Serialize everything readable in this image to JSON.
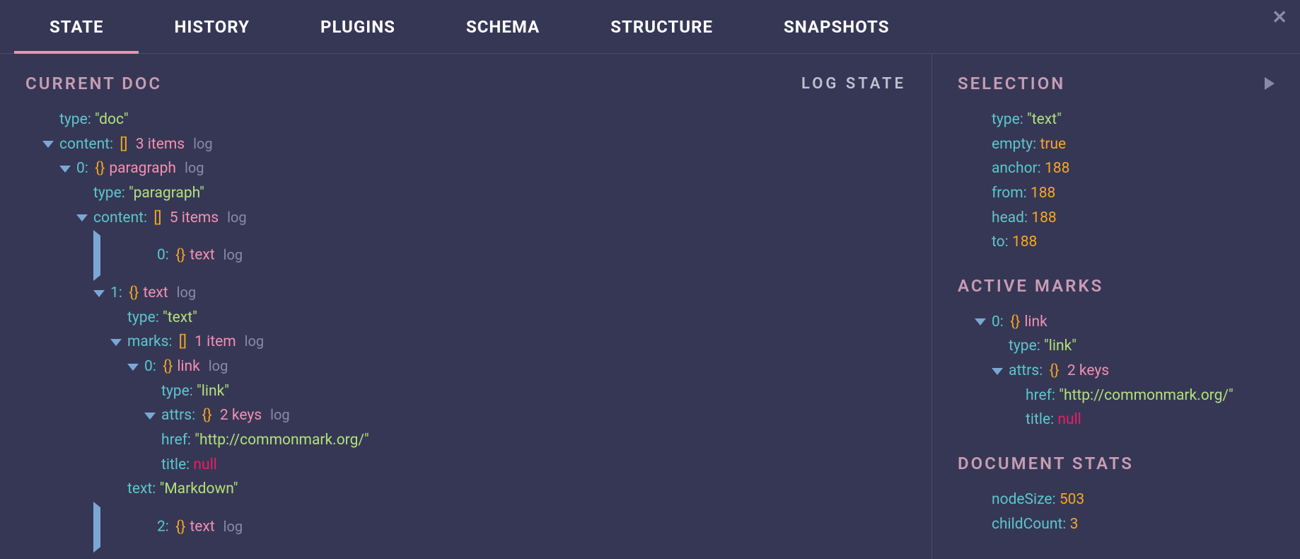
{
  "tabs": {
    "state": "STATE",
    "history": "HISTORY",
    "plugins": "PLUGINS",
    "schema": "SCHEMA",
    "structure": "STRUCTURE",
    "snapshots": "SNAPSHOTS"
  },
  "logState": "LOG STATE",
  "logLabel": "log",
  "headers": {
    "currentDoc": "CURRENT DOC",
    "selection": "SELECTION",
    "activeMarks": "ACTIVE MARKS",
    "documentStats": "DOCUMENT STATS"
  },
  "doc": {
    "typeKey": "type:",
    "typeVal": "\"doc\"",
    "contentKey": "content:",
    "contentBrace": "[]",
    "contentCount": "3 items",
    "item0": {
      "idx": "0:",
      "brace": "{}",
      "name": "paragraph",
      "typeKey": "type:",
      "typeVal": "\"paragraph\"",
      "contentKey": "content:",
      "contentBrace": "[]",
      "contentCount": "5 items",
      "c0": {
        "idx": "0:",
        "brace": "{}",
        "name": "text"
      },
      "c1": {
        "idx": "1:",
        "brace": "{}",
        "name": "text",
        "typeKey": "type:",
        "typeVal": "\"text\"",
        "marksKey": "marks:",
        "marksBrace": "[]",
        "marksCount": "1 item",
        "m0": {
          "idx": "0:",
          "brace": "{}",
          "name": "link",
          "typeKey": "type:",
          "typeVal": "\"link\"",
          "attrsKey": "attrs:",
          "attrsBrace": "{}",
          "attrsCount": "2 keys",
          "hrefKey": "href:",
          "hrefVal": "\"http://commonmark.org/\"",
          "titleKey": "title:",
          "titleVal": "null"
        },
        "textKey": "text:",
        "textVal": "\"Markdown\""
      },
      "c2": {
        "idx": "2:",
        "brace": "{}",
        "name": "text"
      }
    }
  },
  "selection": {
    "typeKey": "type:",
    "typeVal": "\"text\"",
    "emptyKey": "empty:",
    "emptyVal": "true",
    "anchorKey": "anchor:",
    "anchorVal": "188",
    "fromKey": "from:",
    "fromVal": "188",
    "headKey": "head:",
    "headVal": "188",
    "toKey": "to:",
    "toVal": "188"
  },
  "activeMarks": {
    "idx": "0:",
    "brace": "{}",
    "name": "link",
    "typeKey": "type:",
    "typeVal": "\"link\"",
    "attrsKey": "attrs:",
    "attrsBrace": "{}",
    "attrsCount": "2 keys",
    "hrefKey": "href:",
    "hrefVal": "\"http://commonmark.org/\"",
    "titleKey": "title:",
    "titleVal": "null"
  },
  "stats": {
    "nodeSizeKey": "nodeSize:",
    "nodeSizeVal": "503",
    "childCountKey": "childCount:",
    "childCountVal": "3"
  }
}
